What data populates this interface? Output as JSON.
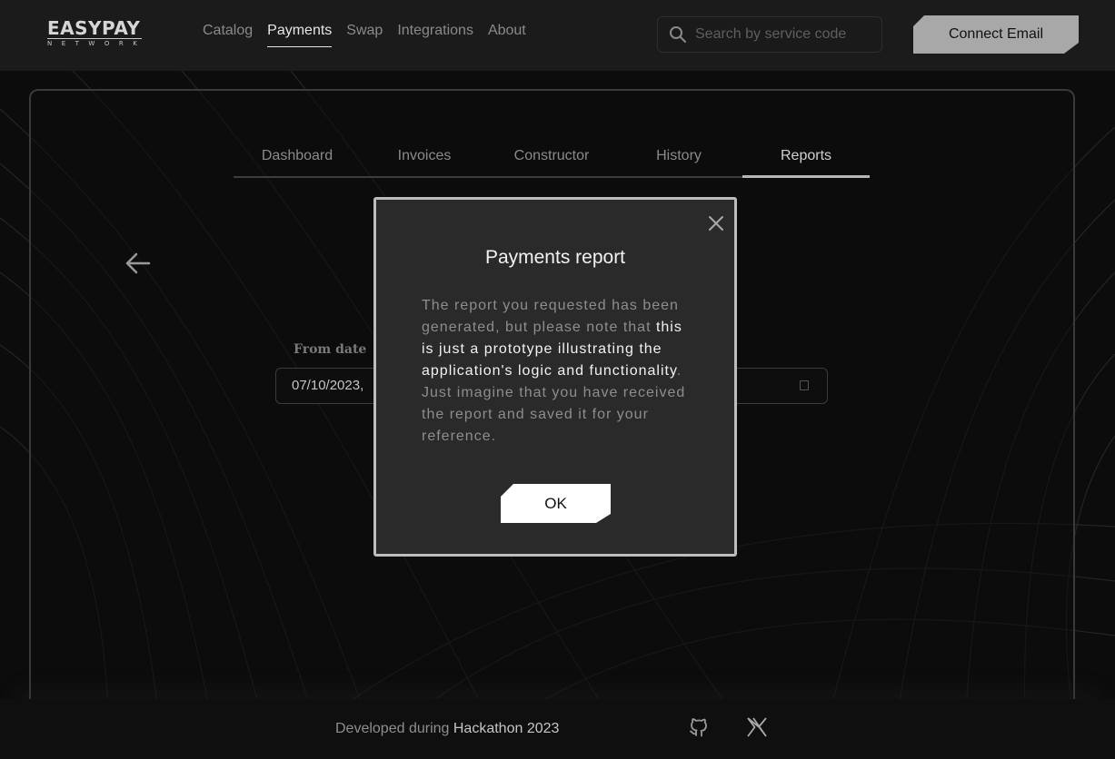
{
  "brand": {
    "name": "EASYPAY",
    "sub": "NETWORK"
  },
  "nav": [
    {
      "label": "Catalog"
    },
    {
      "label": "Payments",
      "active": true
    },
    {
      "label": "Swap"
    },
    {
      "label": "Integrations"
    },
    {
      "label": "About"
    }
  ],
  "search": {
    "placeholder": "Search by service code",
    "icon": "search-icon"
  },
  "header": {
    "connect_label": "Connect Email"
  },
  "tabs": [
    {
      "label": "Dashboard"
    },
    {
      "label": "Invoices"
    },
    {
      "label": "Constructor"
    },
    {
      "label": "History"
    },
    {
      "label": "Reports",
      "active": true
    }
  ],
  "report_form": {
    "from_label": "From date",
    "from_value": "07/10/2023,"
  },
  "modal": {
    "title": "Payments report",
    "body_part1": "The report you requested has been generated, but please note that ",
    "body_emphasis": "this is just a prototype illustrating the application's logic and functionality",
    "body_part2": ". Just imagine that you have received the report and saved it for your reference.",
    "ok_label": "OK"
  },
  "footer": {
    "text": "Developed during ",
    "highlight": "Hackathon 2023",
    "icons": [
      "github-icon",
      "x-icon"
    ]
  },
  "colors": {
    "background": "#0c0c0c",
    "header": "#1b1b1b",
    "modal": "#2a2a2a",
    "accent_button": "#a8a8a8"
  }
}
